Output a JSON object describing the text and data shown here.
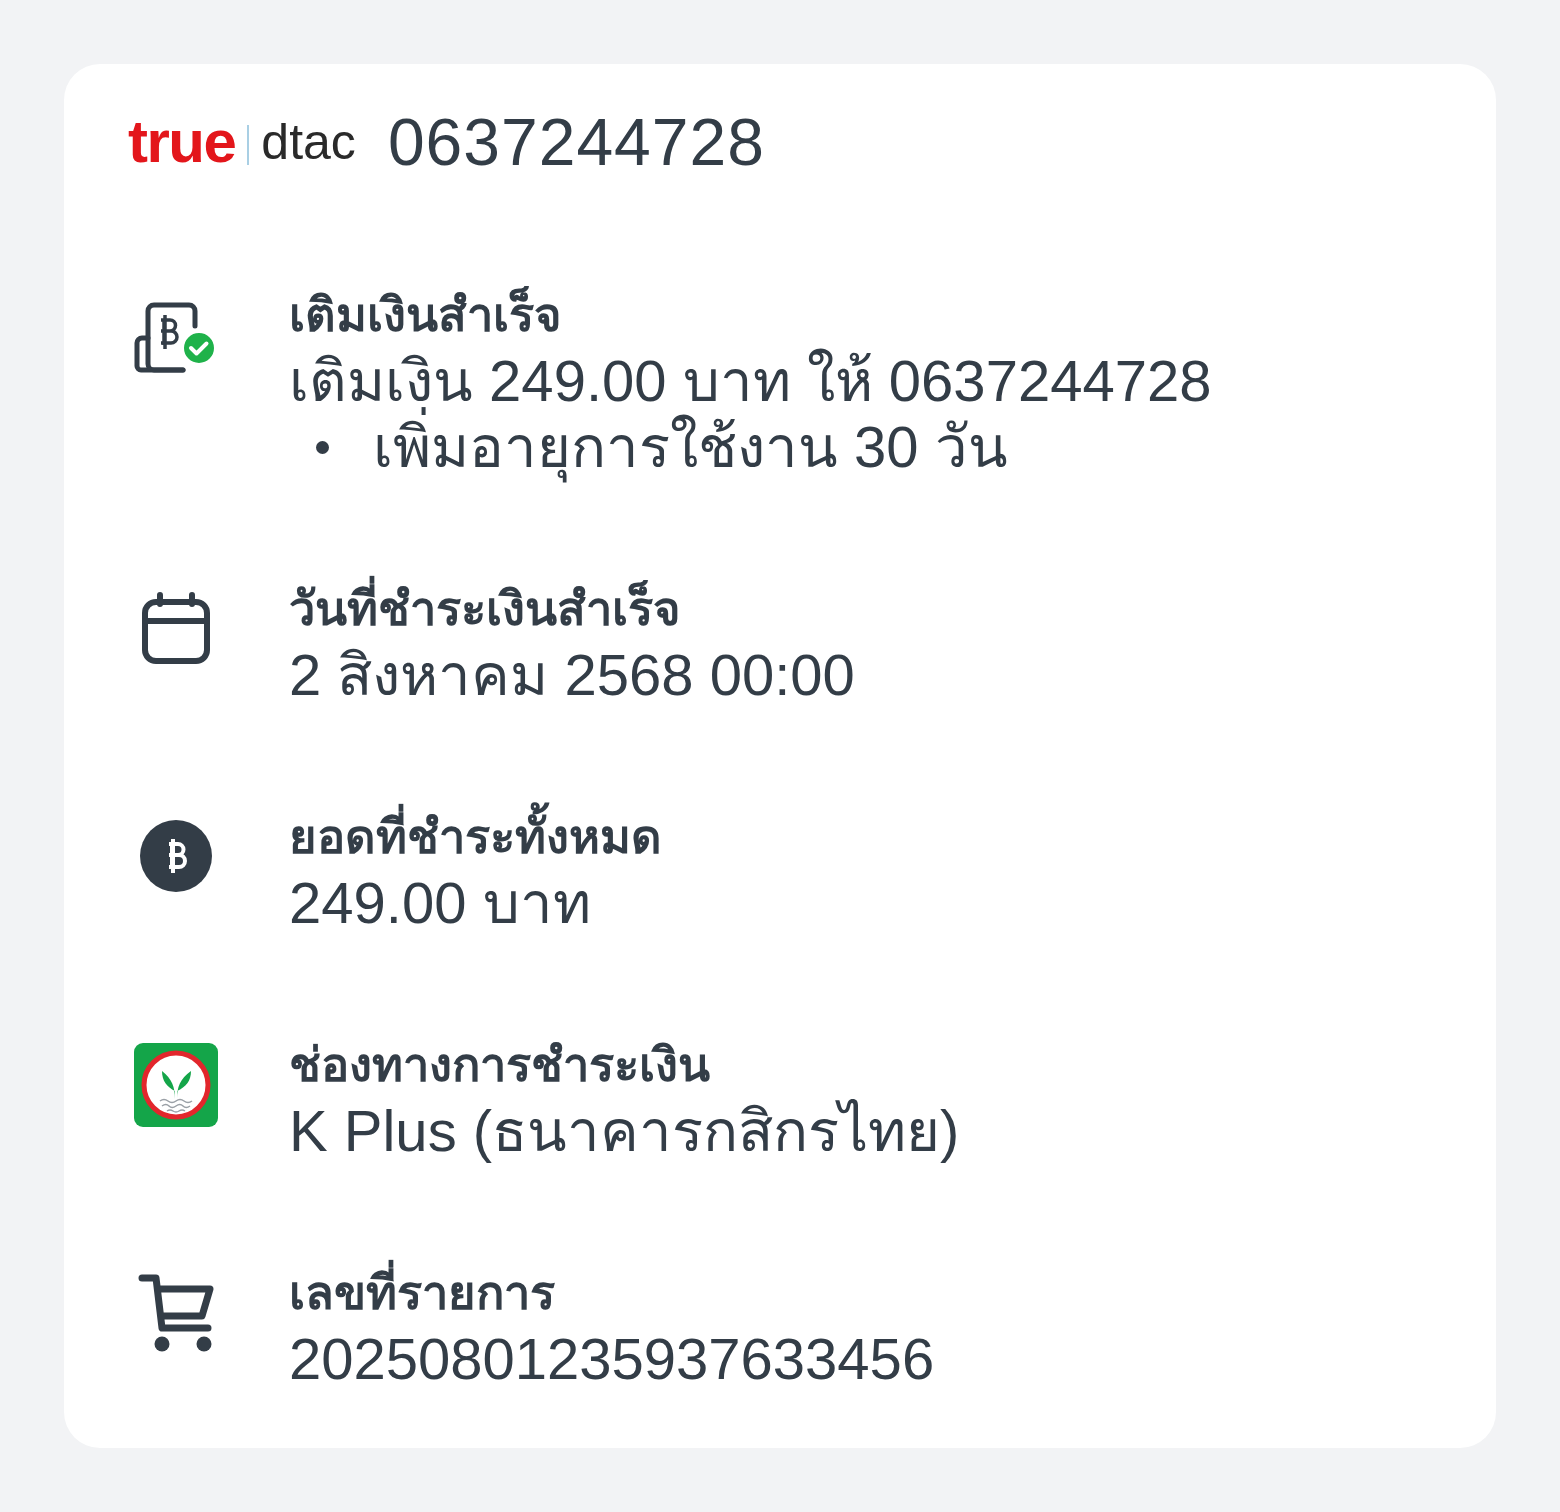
{
  "header": {
    "logo": {
      "primary": "true",
      "secondary": "dtac"
    },
    "phone_number": "0637244728"
  },
  "details": [
    {
      "kind": "topup",
      "title": "เติมเงินสำเร็จ",
      "value": "เติมเงิน 249.00 บาท ให้ 0637244728",
      "bullets": [
        "เพิ่มอายุการใช้งาน 30 วัน"
      ]
    },
    {
      "kind": "calendar",
      "title": "วันที่ชำระเงินสำเร็จ",
      "value": "2 สิงหาคม 2568 00:00"
    },
    {
      "kind": "amount",
      "title": "ยอดที่ชำระทั้งหมด",
      "value": "249.00 บาท"
    },
    {
      "kind": "bank",
      "title": "ช่องทางการชำระเงิน",
      "value": "K Plus (ธนาคารกสิกรไทย)"
    },
    {
      "kind": "order",
      "title": "เลขที่รายการ",
      "value": "20250801235937633456"
    }
  ]
}
